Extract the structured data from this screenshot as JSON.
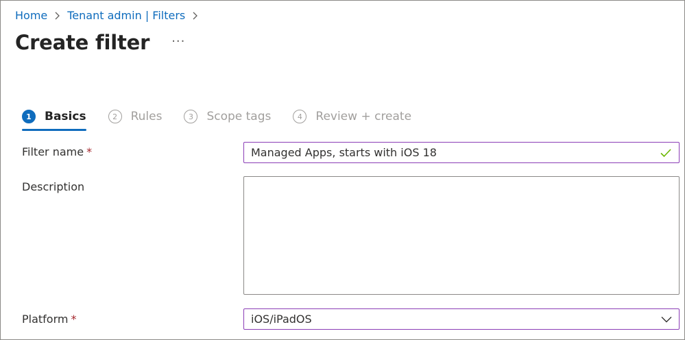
{
  "breadcrumb": {
    "items": [
      "Home",
      "Tenant admin | Filters"
    ]
  },
  "header": {
    "title": "Create filter",
    "more_label": "···"
  },
  "steps": [
    {
      "number": "1",
      "label": "Basics",
      "active": true
    },
    {
      "number": "2",
      "label": "Rules",
      "active": false
    },
    {
      "number": "3",
      "label": "Scope tags",
      "active": false
    },
    {
      "number": "4",
      "label": "Review + create",
      "active": false
    }
  ],
  "form": {
    "filter_name": {
      "label": "Filter name",
      "required_mark": "*",
      "value": "Managed Apps, starts with iOS 18"
    },
    "description": {
      "label": "Description",
      "value": ""
    },
    "platform": {
      "label": "Platform",
      "required_mark": "*",
      "value": "iOS/iPadOS"
    }
  },
  "icons": {
    "chevron-right": "chevron-right-icon",
    "check": "checkmark-icon",
    "dropdown": "chevron-down-icon"
  },
  "colors": {
    "accent": "#0f6cbd",
    "focus_border": "#8a3cb6",
    "required": "#a4262c",
    "valid_check": "#6bb700"
  }
}
